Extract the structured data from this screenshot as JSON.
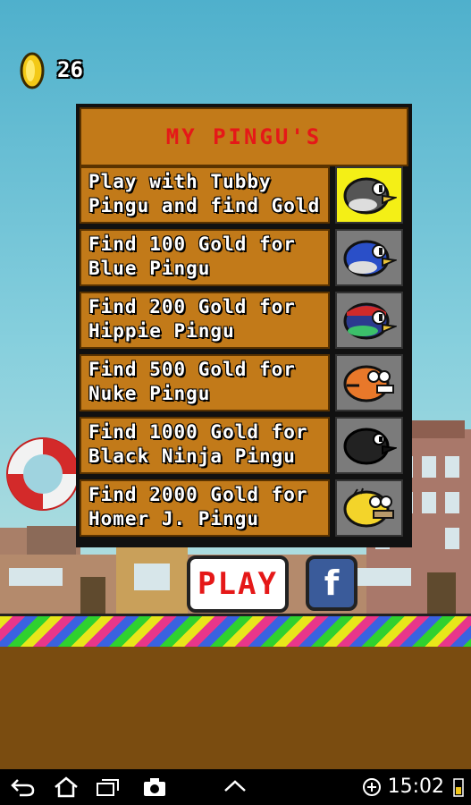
{
  "hud": {
    "coin_icon": "gold-coin",
    "coin_count": "26"
  },
  "panel": {
    "title": "MY PINGU'S",
    "rows": [
      {
        "label": "Play with Tubby Pingu and find Gold",
        "icon": "tubby-pingu",
        "selected": true
      },
      {
        "label": "Find 100 Gold for Blue Pingu",
        "icon": "blue-pingu",
        "selected": false
      },
      {
        "label": "Find 200 Gold for Hippie Pingu",
        "icon": "hippie-pingu",
        "selected": false
      },
      {
        "label": "Find 500 Gold for Nuke Pingu",
        "icon": "nuke-pingu",
        "selected": false
      },
      {
        "label": "Find 1000 Gold for Black Ninja Pingu",
        "icon": "black-ninja-pingu",
        "selected": false
      },
      {
        "label": "Find 2000 Gold for Homer J. Pingu",
        "icon": "homer-pingu",
        "selected": false
      }
    ]
  },
  "buttons": {
    "play_label": "PLAY",
    "facebook_label": "f"
  },
  "status_bar": {
    "time": "15:02"
  },
  "colors": {
    "panel_brown": "#c27a19",
    "title_red": "#e51818",
    "selected_yellow": "#f4ef16",
    "locked_gray": "#7b7b7b",
    "facebook_blue": "#3a5b9a"
  }
}
